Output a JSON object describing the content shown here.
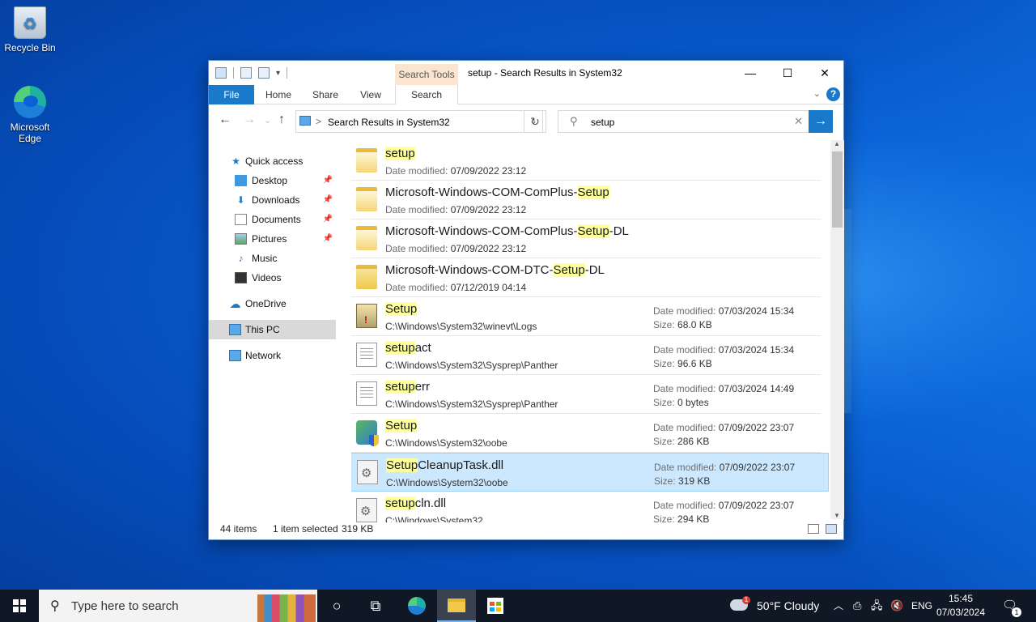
{
  "desktop": {
    "icons": [
      {
        "label": "Recycle Bin",
        "icon": "recycle-bin-icon"
      },
      {
        "label": "Microsoft Edge",
        "icon": "edge-icon"
      }
    ]
  },
  "window": {
    "title": "setup - Search Results in System32",
    "search_tools_label": "Search Tools",
    "ribbon_tabs": [
      "File",
      "Home",
      "Share",
      "View",
      "Search"
    ],
    "address": {
      "crumb": "Search Results in System32",
      "separator": ">"
    },
    "search": {
      "value": "setup"
    },
    "nav": {
      "quick_access": "Quick access",
      "items": [
        {
          "label": "Desktop",
          "pinned": true
        },
        {
          "label": "Downloads",
          "pinned": true
        },
        {
          "label": "Documents",
          "pinned": true
        },
        {
          "label": "Pictures",
          "pinned": true
        },
        {
          "label": "Music",
          "pinned": false
        },
        {
          "label": "Videos",
          "pinned": false
        }
      ],
      "onedrive": "OneDrive",
      "this_pc": "This PC",
      "network": "Network"
    },
    "labels": {
      "date_modified": "Date modified:",
      "size": "Size:"
    },
    "results": [
      {
        "pre": "",
        "hl": "setup",
        "post": "",
        "kind": "folder-doc",
        "date": "07/09/2022 23:12"
      },
      {
        "pre": "Microsoft-Windows-COM-ComPlus-",
        "hl": "Setup",
        "post": "",
        "kind": "folder-doc",
        "date": "07/09/2022 23:12"
      },
      {
        "pre": "Microsoft-Windows-COM-ComPlus-",
        "hl": "Setup",
        "post": "-DL",
        "kind": "folder-doc",
        "date": "07/09/2022 23:12"
      },
      {
        "pre": "Microsoft-Windows-COM-DTC-",
        "hl": "Setup",
        "post": "-DL",
        "kind": "folder",
        "date": "07/12/2019 04:14"
      },
      {
        "pre": "",
        "hl": "Setup",
        "post": "",
        "kind": "log",
        "path": "C:\\Windows\\System32\\winevt\\Logs",
        "date": "07/03/2024 15:34",
        "size": "68.0 KB"
      },
      {
        "pre": "",
        "hl": "setup",
        "post": "act",
        "kind": "text",
        "path": "C:\\Windows\\System32\\Sysprep\\Panther",
        "date": "07/03/2024 15:34",
        "size": "96.6 KB"
      },
      {
        "pre": "",
        "hl": "setup",
        "post": "err",
        "kind": "text",
        "path": "C:\\Windows\\System32\\Sysprep\\Panther",
        "date": "07/03/2024 14:49",
        "size": "0 bytes"
      },
      {
        "pre": "",
        "hl": "Setup",
        "post": "",
        "kind": "oobe",
        "path": "C:\\Windows\\System32\\oobe",
        "date": "07/09/2022 23:07",
        "size": "286 KB"
      },
      {
        "pre": "",
        "hl": "Setup",
        "post": "CleanupTask.dll",
        "kind": "dll",
        "path": "C:\\Windows\\System32\\oobe",
        "date": "07/09/2022 23:07",
        "size": "319 KB",
        "selected": true
      },
      {
        "pre": "",
        "hl": "setup",
        "post": "cln.dll",
        "kind": "dll",
        "path": "C:\\Windows\\System32",
        "date": "07/09/2022 23:07",
        "size": "294 KB"
      }
    ],
    "status": {
      "items": "44 items",
      "selected": "1 item selected",
      "size": "319 KB"
    }
  },
  "taskbar": {
    "search_placeholder": "Type here to search",
    "weather": "50°F  Cloudy",
    "weather_badge": "1",
    "lang": "ENG",
    "time": "15:45",
    "date": "07/03/2024",
    "notification_count": "1"
  },
  "colors": {
    "accent": "#1979ca",
    "highlight": "#ffff9b",
    "selection": "#cce8ff",
    "search_tools": "#fbe4d0"
  }
}
